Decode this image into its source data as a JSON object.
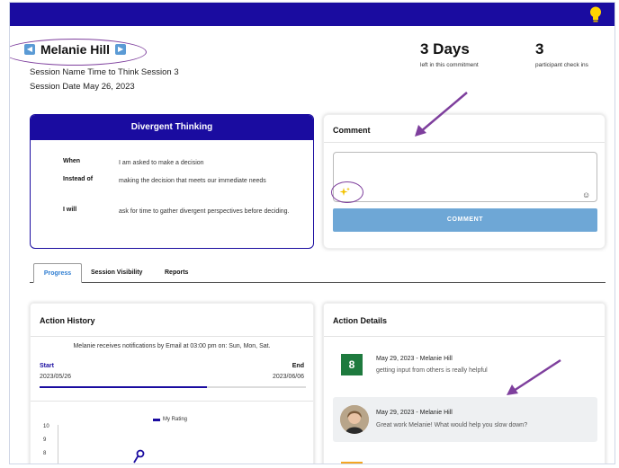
{
  "colors": {
    "brand": "#1a0ca0",
    "button": "#6ea7d6",
    "rating_badge": "#1e7a3e",
    "annotation": "#7e3f9d"
  },
  "header": {
    "person_name": "Melanie Hill",
    "prev_icon": "chevron-left-icon",
    "next_icon": "chevron-right-icon",
    "tip_icon": "lightbulb-icon"
  },
  "session": {
    "name_line": "Session Name Time to Think Session 3",
    "date_line": "Session Date May 26, 2023"
  },
  "stats": {
    "days_value": "3 Days",
    "days_label": "left in this commitment",
    "checkins_value": "3",
    "checkins_label": "participant check ins"
  },
  "divergent": {
    "title": "Divergent Thinking",
    "rows": [
      {
        "label": "When",
        "value": "I am asked to make a decision"
      },
      {
        "label": "Instead of",
        "value": "making the decision that meets our immediate needs"
      },
      {
        "label": "I will",
        "value": "ask for time to gather divergent perspectives before deciding."
      }
    ]
  },
  "comment": {
    "title": "Comment",
    "placeholder": "",
    "button_label": "COMMENT",
    "sparkle_icon": "sparkle-icon",
    "emoji_icon": "smiley-icon"
  },
  "tabs": [
    {
      "label": "Progress",
      "active": true
    },
    {
      "label": "Session Visibility",
      "active": false
    },
    {
      "label": "Reports",
      "active": false
    }
  ],
  "history": {
    "title": "Action History",
    "notification": "Melanie receives notifications by Email at 03:00 pm on: Sun, Mon, Sat.",
    "start_label": "Start",
    "end_label": "End",
    "start_date": "2023/05/26",
    "end_date": "2023/06/06",
    "progress_fraction": 0.63,
    "legend": "My Rating",
    "y_ticks": [
      "10",
      "9",
      "8"
    ]
  },
  "details": {
    "title": "Action Details",
    "entries": [
      {
        "badge": "8",
        "meta": "May 29, 2023 - Melanie Hill",
        "text": "getting input from others is really helpful"
      },
      {
        "meta": "May 29, 2023 - Melanie Hill",
        "text": "Great work Melanie! What would help you slow down?"
      }
    ]
  }
}
